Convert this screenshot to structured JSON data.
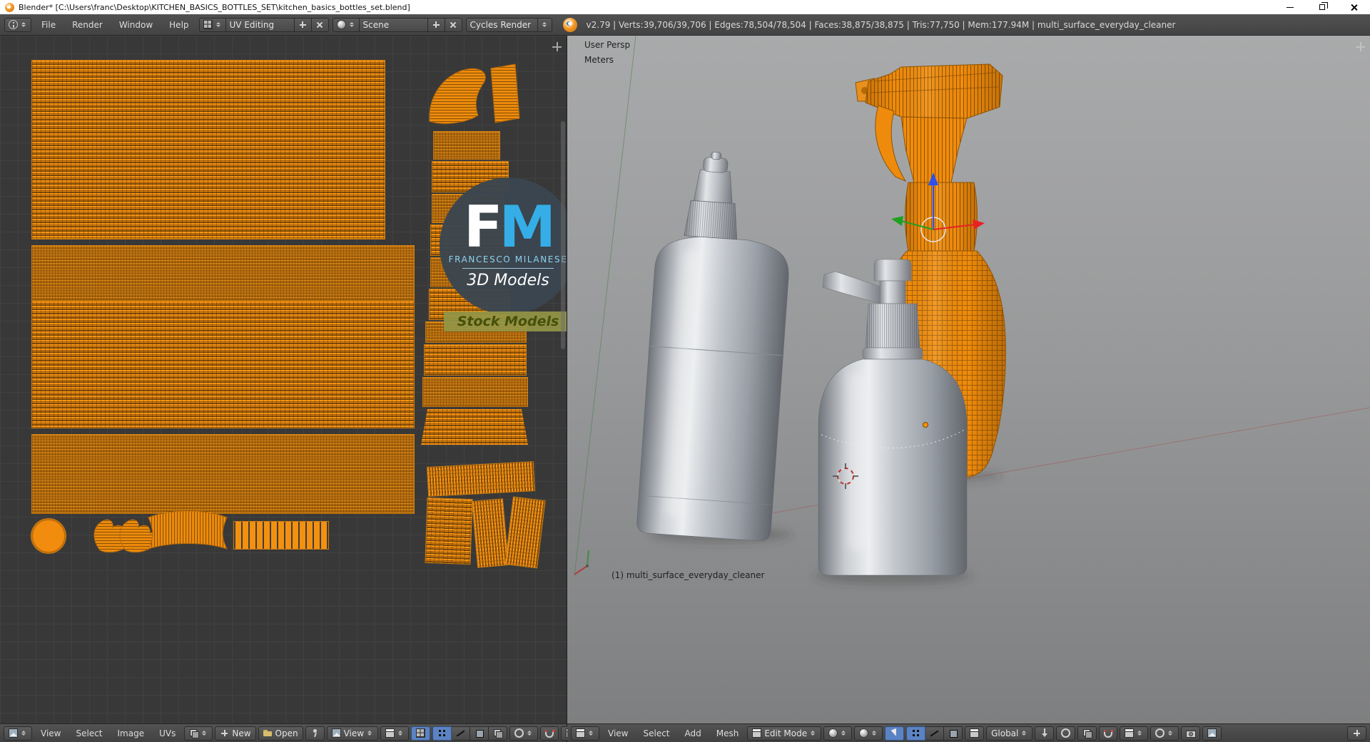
{
  "titlebar": {
    "title": "Blender* [C:\\Users\\franc\\Desktop\\KITCHEN_BASICS_BOTTLES_SET\\kitchen_basics_bottles_set.blend]"
  },
  "header": {
    "menus": [
      "File",
      "Render",
      "Window",
      "Help"
    ],
    "layout": "UV Editing",
    "scene": "Scene",
    "engine": "Cycles Render",
    "stats": "v2.79 | Verts:39,706/39,706 | Edges:78,504/78,504 | Faces:38,875/38,875 | Tris:77,750 | Mem:177.94M | multi_surface_everyday_cleaner"
  },
  "uv_editor": {
    "footer": {
      "menus": [
        "View",
        "Select",
        "Image",
        "UVs"
      ],
      "new_label": "New",
      "open_label": "Open",
      "view_label": "View"
    }
  },
  "viewport": {
    "persp_label": "User Persp",
    "unit_label": "Meters",
    "object_label": "(1) multi_surface_everyday_cleaner",
    "footer": {
      "menus": [
        "View",
        "Select",
        "Add",
        "Mesh"
      ],
      "mode_label": "Edit Mode",
      "orientation_label": "Global"
    }
  },
  "watermark": {
    "initial_f": "F",
    "initial_m": "M",
    "name": "FRANCESCO MILANESE",
    "tagline": "3D Models",
    "banner": "Stock Models"
  },
  "colors": {
    "uv_orange": "#f5920a",
    "logo_blue": "#35aee8",
    "selection_blue": "#5b83c4",
    "banner_olive": "#949646"
  }
}
